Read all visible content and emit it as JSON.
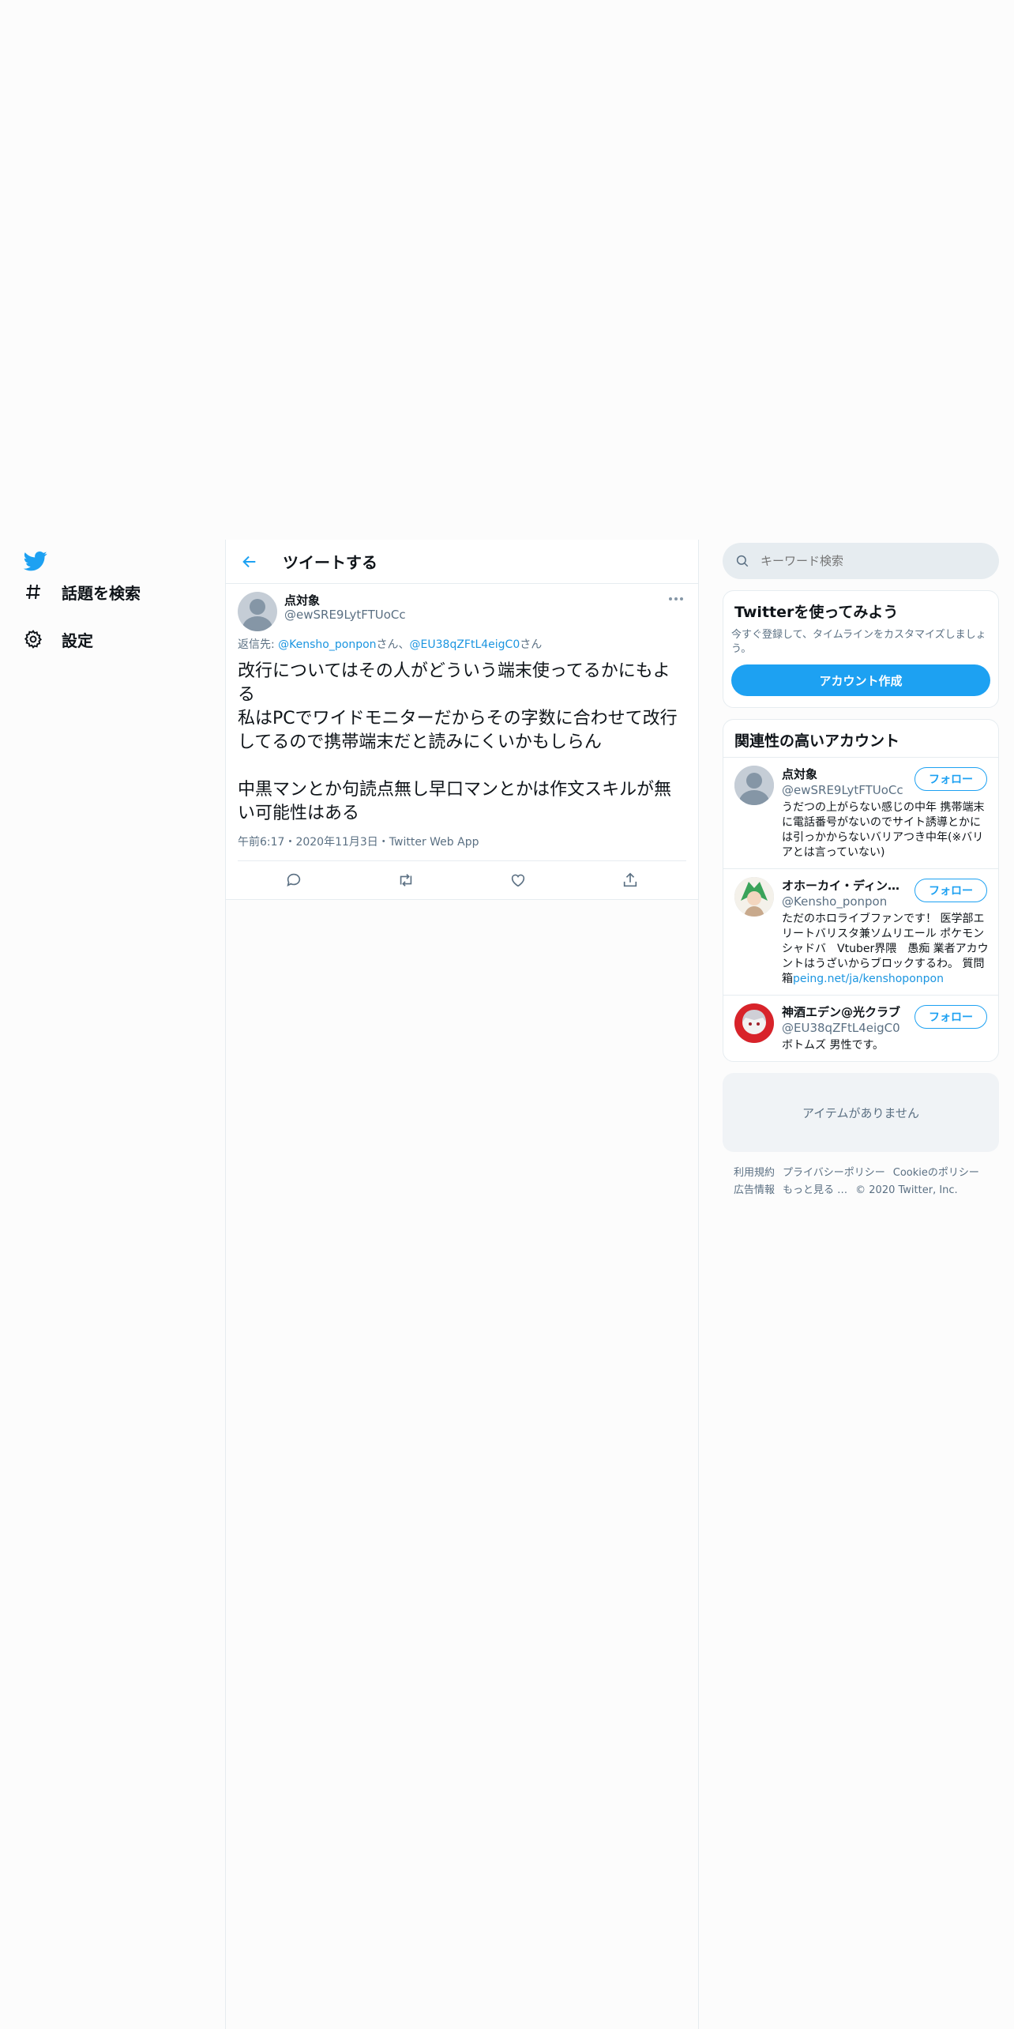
{
  "nav": {
    "explore_label": "話題を検索",
    "settings_label": "設定"
  },
  "main": {
    "title": "ツイートする"
  },
  "tweet": {
    "author_name": "点対象",
    "author_handle": "@ewSRE9LytFTUoCc",
    "reply_prefix": "返信先: ",
    "reply_user1": "@Kensho_ponpon",
    "reply_sep": "さん、",
    "reply_user2": "@EU38qZFtL4eigC0",
    "reply_suffix": "さん",
    "text": "改行についてはその人がどういう端末使ってるかにもよる\n私はPCでワイドモニターだからその字数に合わせて改行してるので携帯端末だと読みにくいかもしらん\n\n中黒マンとか句読点無し早口マンとかは作文スキルが無い可能性はある",
    "meta": "午前6:17・2020年11月3日・Twitter Web App"
  },
  "search": {
    "placeholder": "キーワード検索"
  },
  "signup": {
    "title": "Twitterを使ってみよう",
    "description": "今すぐ登録して、タイムラインをカスタマイズしましょう。",
    "button": "アカウント作成"
  },
  "related": {
    "title": "関連性の高いアカウント",
    "follow_label": "フォロー",
    "accounts": [
      {
        "name": "点対象",
        "handle": "@ewSRE9LytFTUoCc",
        "bio": "うだつの上がらない感じの中年 携帯端末に電話番号がないのでサイト誘導とかには引っかからないバリアつき中年(※バリアとは言っていない)"
      },
      {
        "name": "オホーカイ・ディン…",
        "handle": "@Kensho_ponpon",
        "bio": "ただのホロライブファンです！ 医学部エリートバリスタ兼ソムリエール ポケモン　シャドバ　Vtuber界隈　愚痴 業者アカウントはうざいからブロックするわ。 質問箱",
        "bio_link": "peing.net/ja/kenshoponpon"
      },
      {
        "name": "神酒エデン@光クラブ",
        "handle": "@EU38qZFtL4eigC0",
        "bio": "ボトムズ 男性です。"
      }
    ]
  },
  "empty": {
    "label": "アイテムがありません"
  },
  "footer": {
    "terms": "利用規約",
    "privacy": "プライバシーポリシー",
    "cookie": "Cookieのポリシー",
    "ads": "広告情報",
    "more": "もっと見る …",
    "copyright": "© 2020 Twitter, Inc."
  },
  "colors": {
    "accent": "#1da1f2",
    "link": "#1b95e0",
    "secondary_text": "#5b7083",
    "border": "#e6ecf0"
  }
}
